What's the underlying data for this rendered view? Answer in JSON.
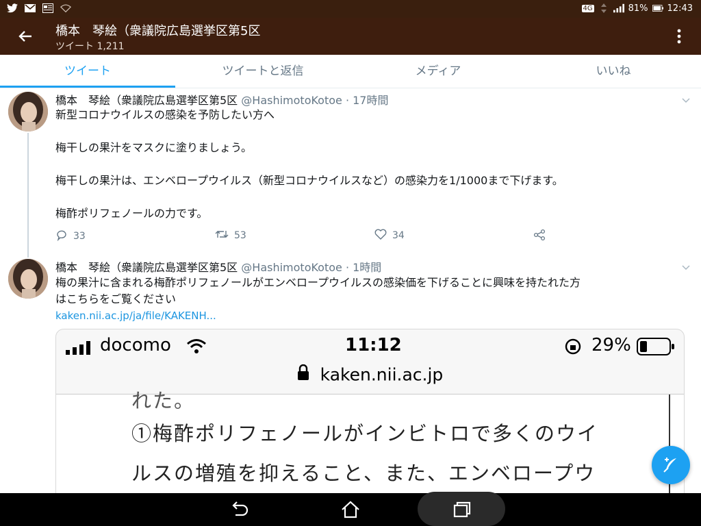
{
  "status_bar": {
    "battery": "81%",
    "time": "12:43",
    "network": "4G"
  },
  "header": {
    "title": "橋本　琴絵（衆議院広島選挙区第5区",
    "subtitle": "ツイート 1,211"
  },
  "tabs": [
    {
      "label": "ツイート",
      "active": true
    },
    {
      "label": "ツイートと返信",
      "active": false
    },
    {
      "label": "メディア",
      "active": false
    },
    {
      "label": "いいね",
      "active": false
    }
  ],
  "tweets": [
    {
      "name": "橋本　琴絵（衆議院広島選挙区第5区",
      "meta": "@HashimotoKotoe · 17時間",
      "text": "新型コロナウイルスの感染を予防したい方へ\n\n梅干しの果汁をマスクに塗りましょう。\n\n梅干しの果汁は、エンベロープウイルス（新型コロナウイルスなど）の感染力を1/1000まで下げます。\n\n梅酢ポリフェノールの力です。",
      "replies": "33",
      "retweets": "53",
      "likes": "34"
    },
    {
      "name": "橋本　琴絵（衆議院広島選挙区第5区",
      "meta": "@HashimotoKotoe · 1時間",
      "text": "梅の果汁に含まれる梅酢ポリフェノールがエンベロープウイルスの感染価を下げることに興味を持たれた方\nはこちらをご覧ください",
      "link": "kaken.nii.ac.jp/ja/file/KAKENH..."
    }
  ],
  "embedded_image": {
    "carrier": "docomo",
    "time": "11:12",
    "battery": "29%",
    "url": "kaken.nii.ac.jp",
    "line_fragment": "れた。",
    "line1": "①梅酢ポリフェノールがインビトロで多くのウイ",
    "line2": "ルスの増殖を抑えること、また、エンベロープウ"
  },
  "colors": {
    "status_bar": "#3a1f0e",
    "app_bar": "#3e1e0e",
    "accent": "#1da1f2",
    "muted": "#657786",
    "link": "#1b95e0"
  }
}
